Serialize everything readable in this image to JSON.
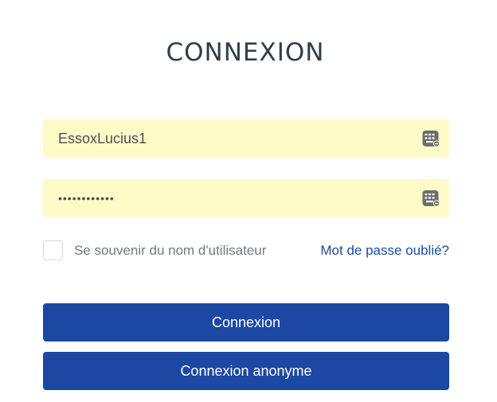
{
  "title": "CONNEXION",
  "username": {
    "value": "EssoxLucius1",
    "icon": "keyboard-icon"
  },
  "password": {
    "value": "••••••••••••",
    "icon": "keyboard-icon"
  },
  "remember": {
    "label": "Se souvenir du nom d'utilisateur",
    "checked": false
  },
  "forgot_link": "Mot de passe oublié?",
  "buttons": {
    "login": "Connexion",
    "anonymous": "Connexion anonyme"
  },
  "colors": {
    "title": "#2f3e4a",
    "field_bg": "#fefbc9",
    "primary": "#1c48a4",
    "link": "#1a4aa0"
  }
}
